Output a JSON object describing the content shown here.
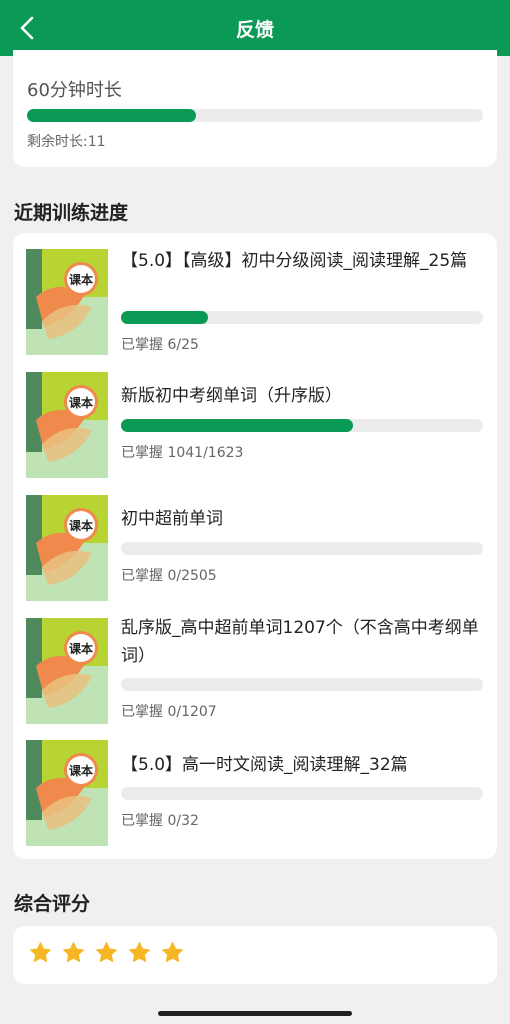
{
  "header": {
    "title": "反馈"
  },
  "duration": {
    "label": "60分钟时长",
    "progress_fraction": 0.37,
    "remaining_text": "剩余时长:11"
  },
  "progress_section": {
    "title": "近期训练进度",
    "items": [
      {
        "title": "【5.0】【高级】初中分级阅读_阅读理解_25篇",
        "mastered": 6,
        "total": 25,
        "count_text": "已掌握 6/25"
      },
      {
        "title": "新版初中考纲单词（升序版）",
        "mastered": 1041,
        "total": 1623,
        "count_text": "已掌握 1041/1623"
      },
      {
        "title": "初中超前单词",
        "mastered": 0,
        "total": 2505,
        "count_text": "已掌握 0/2505"
      },
      {
        "title": "乱序版_高中超前单词1207个（不含高中考纲单词）",
        "mastered": 0,
        "total": 1207,
        "count_text": "已掌握 0/1207"
      },
      {
        "title": "【5.0】高一时文阅读_阅读理解_32篇",
        "mastered": 0,
        "total": 32,
        "count_text": "已掌握 0/32"
      }
    ],
    "cover_label": "课本"
  },
  "rating_section": {
    "title": "综合评分",
    "stars": 5,
    "max_stars": 5
  },
  "colors": {
    "brand_green": "#0b9a55",
    "star_yellow": "#f6b723"
  },
  "icons": {
    "back": "chevron-left-icon",
    "star": "star-icon"
  }
}
